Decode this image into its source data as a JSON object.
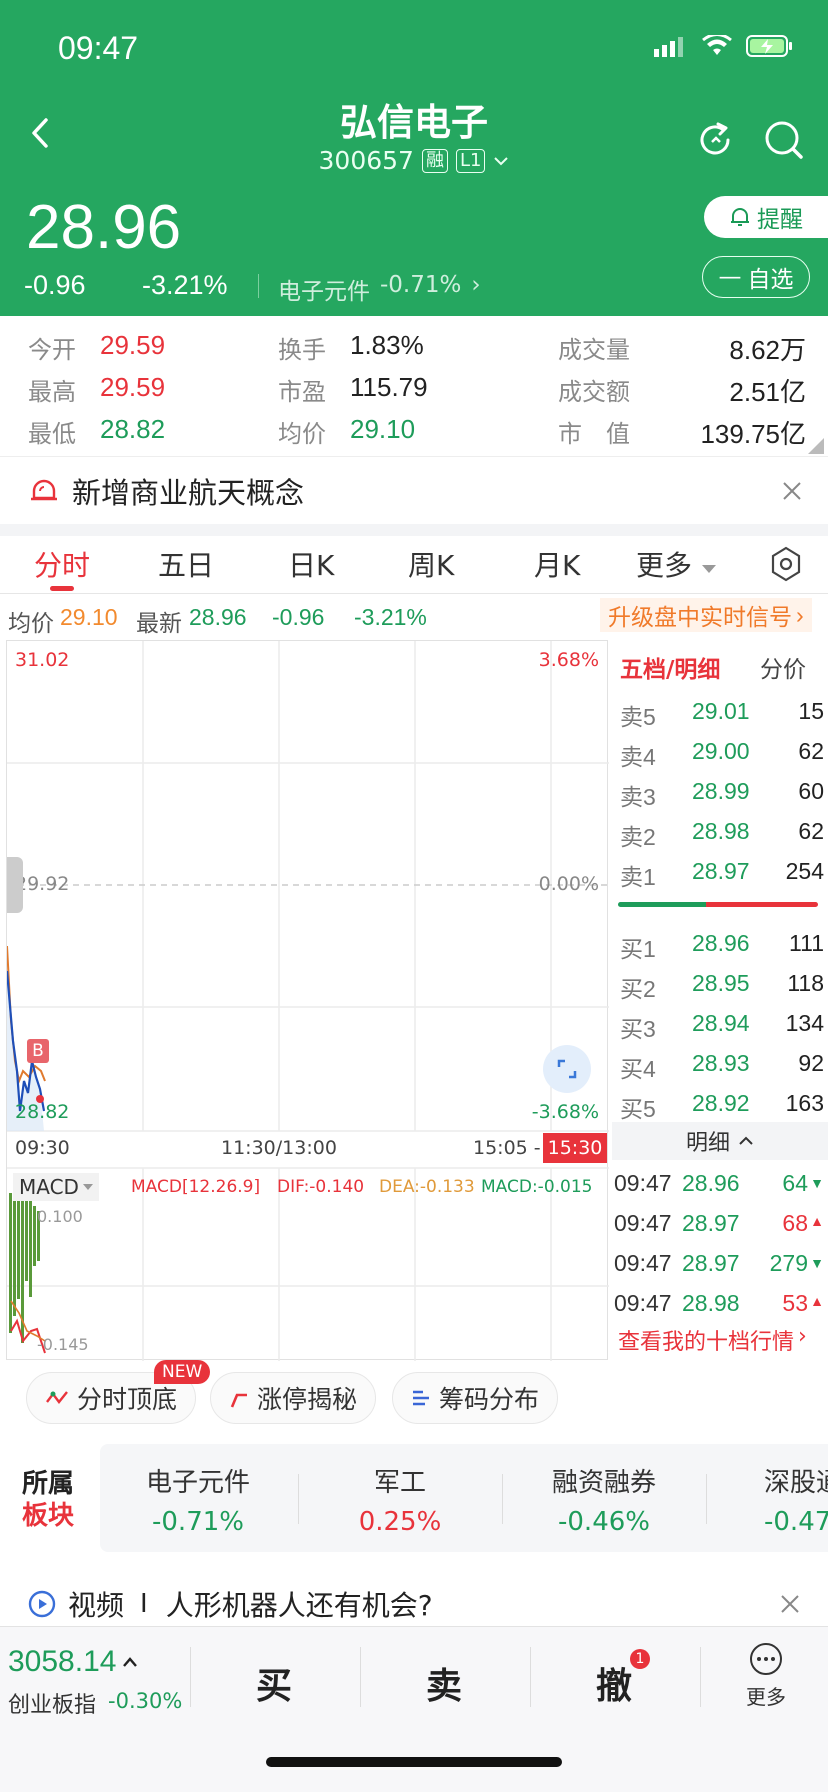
{
  "status_bar": {
    "time": "09:47"
  },
  "header": {
    "title": "弘信电子",
    "code": "300657",
    "tag_margin": "融",
    "tag_level": "L1",
    "price": "28.96",
    "change": "-0.96",
    "change_pct": "-3.21%",
    "sector_name": "电子元件",
    "sector_change": "-0.71%",
    "remind_label": "提醒",
    "watch_label": "自选"
  },
  "stats": {
    "open_label": "今开",
    "open": "29.59",
    "high_label": "最高",
    "high": "29.59",
    "low_label": "最低",
    "low": "28.82",
    "turnover_label": "换手",
    "turnover": "1.83%",
    "pe_label": "市盈",
    "pe": "115.79",
    "avg_label": "均价",
    "avg": "29.10",
    "volume_label": "成交量",
    "volume": "8.62万",
    "amount_label": "成交额",
    "amount": "2.51亿",
    "mcap_label": "市　值",
    "mcap": "139.75亿"
  },
  "banner": {
    "text": "新增商业航天概念"
  },
  "tabs": [
    {
      "label": "分时",
      "active": true
    },
    {
      "label": "五日"
    },
    {
      "label": "日K"
    },
    {
      "label": "周K"
    },
    {
      "label": "月K"
    },
    {
      "label": "更多"
    }
  ],
  "infoline": {
    "avg_label": "均价",
    "avg": "29.10",
    "last_label": "最新",
    "last": "28.96",
    "chg": "-0.96",
    "chg_pct": "-3.21%",
    "upgrade": "升级盘中实时信号"
  },
  "chart": {
    "y_top": "31.02",
    "y_mid": "29.92",
    "y_low": "28.82",
    "pct_top": "3.68%",
    "pct_mid": "0.00%",
    "pct_low": "-3.68%",
    "x_start": "09:30",
    "x_mid": "11:30/13:00",
    "x_right": "15:05 -",
    "x_end": "15:30",
    "b_marker": "B"
  },
  "macd": {
    "selector": "MACD",
    "params": "MACD[12.26.9]",
    "dif": "DIF:-0.140",
    "dea": "DEA:-0.133",
    "macd": "MACD:-0.015",
    "top": "0.100",
    "bottom": "-0.145"
  },
  "orderbook": {
    "tab_active": "五档/明细",
    "tab_other": "分价",
    "asks": [
      {
        "label": "卖5",
        "price": "29.01",
        "vol": "15"
      },
      {
        "label": "卖4",
        "price": "29.00",
        "vol": "62"
      },
      {
        "label": "卖3",
        "price": "28.99",
        "vol": "60"
      },
      {
        "label": "卖2",
        "price": "28.98",
        "vol": "62"
      },
      {
        "label": "卖1",
        "price": "28.97",
        "vol": "254"
      }
    ],
    "bids": [
      {
        "label": "买1",
        "price": "28.96",
        "vol": "111"
      },
      {
        "label": "买2",
        "price": "28.95",
        "vol": "118"
      },
      {
        "label": "买3",
        "price": "28.94",
        "vol": "134"
      },
      {
        "label": "买4",
        "price": "28.93",
        "vol": "92"
      },
      {
        "label": "买5",
        "price": "28.92",
        "vol": "163"
      }
    ],
    "detail_label": "明细",
    "ticks": [
      {
        "time": "09:47",
        "price": "28.96",
        "vol": "64",
        "dir": "down"
      },
      {
        "time": "09:47",
        "price": "28.97",
        "vol": "68",
        "dir": "up"
      },
      {
        "time": "09:47",
        "price": "28.97",
        "vol": "279",
        "dir": "down"
      },
      {
        "time": "09:47",
        "price": "28.98",
        "vol": "53",
        "dir": "up"
      }
    ],
    "ten_level": "查看我的十档行情"
  },
  "feature_pills": [
    {
      "label": "分时顶底",
      "badge": "NEW"
    },
    {
      "label": "涨停揭秘"
    },
    {
      "label": "筹码分布"
    }
  ],
  "sectors": {
    "title_1": "所属",
    "title_2": "板块",
    "items": [
      {
        "name": "电子元件",
        "change": "-0.71%"
      },
      {
        "name": "军工",
        "change": "0.25%"
      },
      {
        "name": "融资融券",
        "change": "-0.46%"
      },
      {
        "name": "深股通",
        "change": "-0.47"
      }
    ]
  },
  "video": {
    "label": "视频",
    "sep": "I",
    "title": "人形机器人还有机会?"
  },
  "bottom_bar": {
    "index_value": "3058.14",
    "index_name": "创业板指",
    "index_change": "-0.30%",
    "buy": "买",
    "sell": "卖",
    "cancel": "撤",
    "cancel_badge": "1",
    "more": "更多"
  },
  "colors": {
    "brand_green": "#25a760",
    "up_red": "#e8333b",
    "down_green": "#1e9c5a",
    "accent_orange": "#f28a2e"
  }
}
